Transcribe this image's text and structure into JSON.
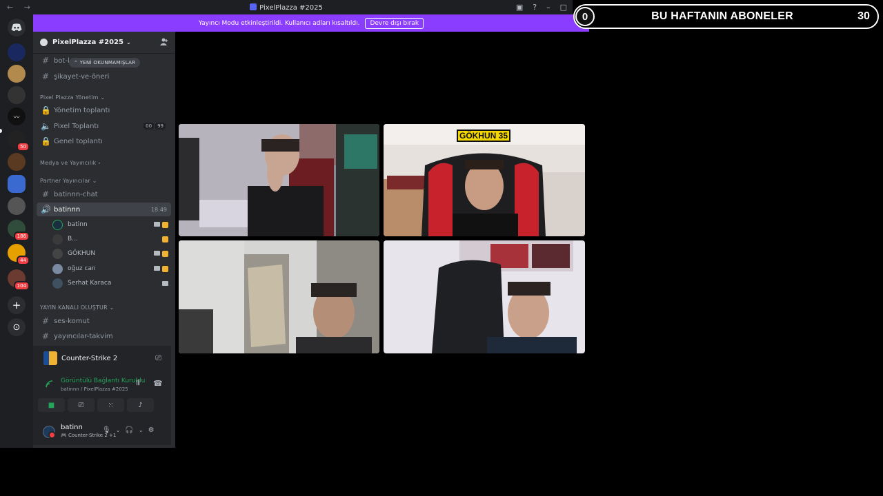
{
  "window": {
    "title": "PixelPlazza #2025",
    "nav_arrows": "← →",
    "controls": [
      "▣",
      "?",
      "–",
      "□"
    ]
  },
  "banner": {
    "text": "Yayıncı Modu etkinleştirildi. Kullanıcı adları kısaltıldı.",
    "button": "Devre dışı bırak"
  },
  "overlay": {
    "left_count": "0",
    "label": "BU HAFTANIN ABONELER",
    "right_count": "30"
  },
  "server_rail": {
    "badges": [
      "50",
      "186",
      "44",
      "104"
    ],
    "add_icon": "+",
    "discover_icon": "⊙"
  },
  "server": {
    "name": "PixelPlazza #2025",
    "chevron": "⌄",
    "invite_icon": "person-add-icon"
  },
  "new_unreads": "⌃ YENİ OKUNMAMIŞLAR",
  "channels": {
    "bot": "bot-l",
    "sikayet": "şikayet-ve-öneri",
    "cat_yonetim": "Pixel Plazza Yönetim ⌄",
    "yonetim_toplanti": "Yönetim toplantı",
    "pixel_toplanti": "Pixel Toplantı",
    "pixel_toplanti_pills": [
      "00",
      "99"
    ],
    "genel_toplanti": "Genel toplantı",
    "cat_medya": "Medya ve Yayıncılık ›",
    "cat_partner": "Partner Yayıncılar ⌄",
    "batinnn_chat": "batinnn-chat",
    "batinnn": "batinnn",
    "batinnn_time": "18:49",
    "cat_yayin": "YAYIN KANALI OLUŞTUR ⌄",
    "ses_komut": "ses-komut",
    "takvim": "yayıncılar-takvim"
  },
  "voice_users": [
    {
      "name": "batinn",
      "color": "#1b2e3f"
    },
    {
      "name": "B...",
      "color": "#3a3a3a"
    },
    {
      "name": "GÖKHUN",
      "color": "#444"
    },
    {
      "name": "oğuz can",
      "color": "#7a8aa0"
    },
    {
      "name": "Serhat Karaca",
      "color": "#3f5060"
    }
  ],
  "activity": {
    "game": "Counter-Strike 2"
  },
  "voice_panel": {
    "status": "Görüntülü Bağlantı Kuruldu",
    "location": "batinnn / PixelPlazza #2025"
  },
  "user": {
    "name": "batinn",
    "status": "🎮 Counter-Strike 2 +1"
  },
  "video": {
    "plate_text": "GÖKHUN 35"
  },
  "colors": {
    "accent": "#5865f2",
    "banner": "#8b3dff",
    "online": "#23a55a",
    "danger": "#f23f43"
  }
}
